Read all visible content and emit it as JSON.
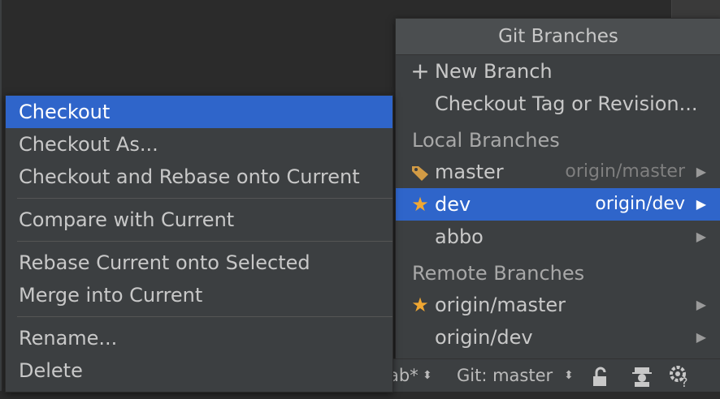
{
  "branches_popup": {
    "title": "Git Branches",
    "new_branch": "New Branch",
    "checkout_tag": "Checkout Tag or Revision...",
    "local_header": "Local Branches",
    "local": [
      {
        "name": "master",
        "remote": "origin/master",
        "icon": "tag-icon"
      },
      {
        "name": "dev",
        "remote": "origin/dev",
        "icon": "star-icon",
        "selected": true
      },
      {
        "name": "abbo",
        "remote": ""
      }
    ],
    "remote_header": "Remote Branches",
    "remote": [
      {
        "name": "origin/master",
        "icon": "star-icon"
      },
      {
        "name": "origin/dev"
      }
    ]
  },
  "context_menu": {
    "items": [
      "Checkout",
      "Checkout As...",
      "Checkout and Rebase onto Current",
      "Compare with Current",
      "Rebase Current onto Selected",
      "Merge into Current",
      "Rename...",
      "Delete"
    ]
  },
  "status_bar": {
    "left_text": "ab*",
    "git": "Git: master"
  },
  "colors": {
    "selection": "#2f65ca",
    "star": "#f0a732",
    "background": "#2b2b2b",
    "popup": "#3c3f41"
  }
}
